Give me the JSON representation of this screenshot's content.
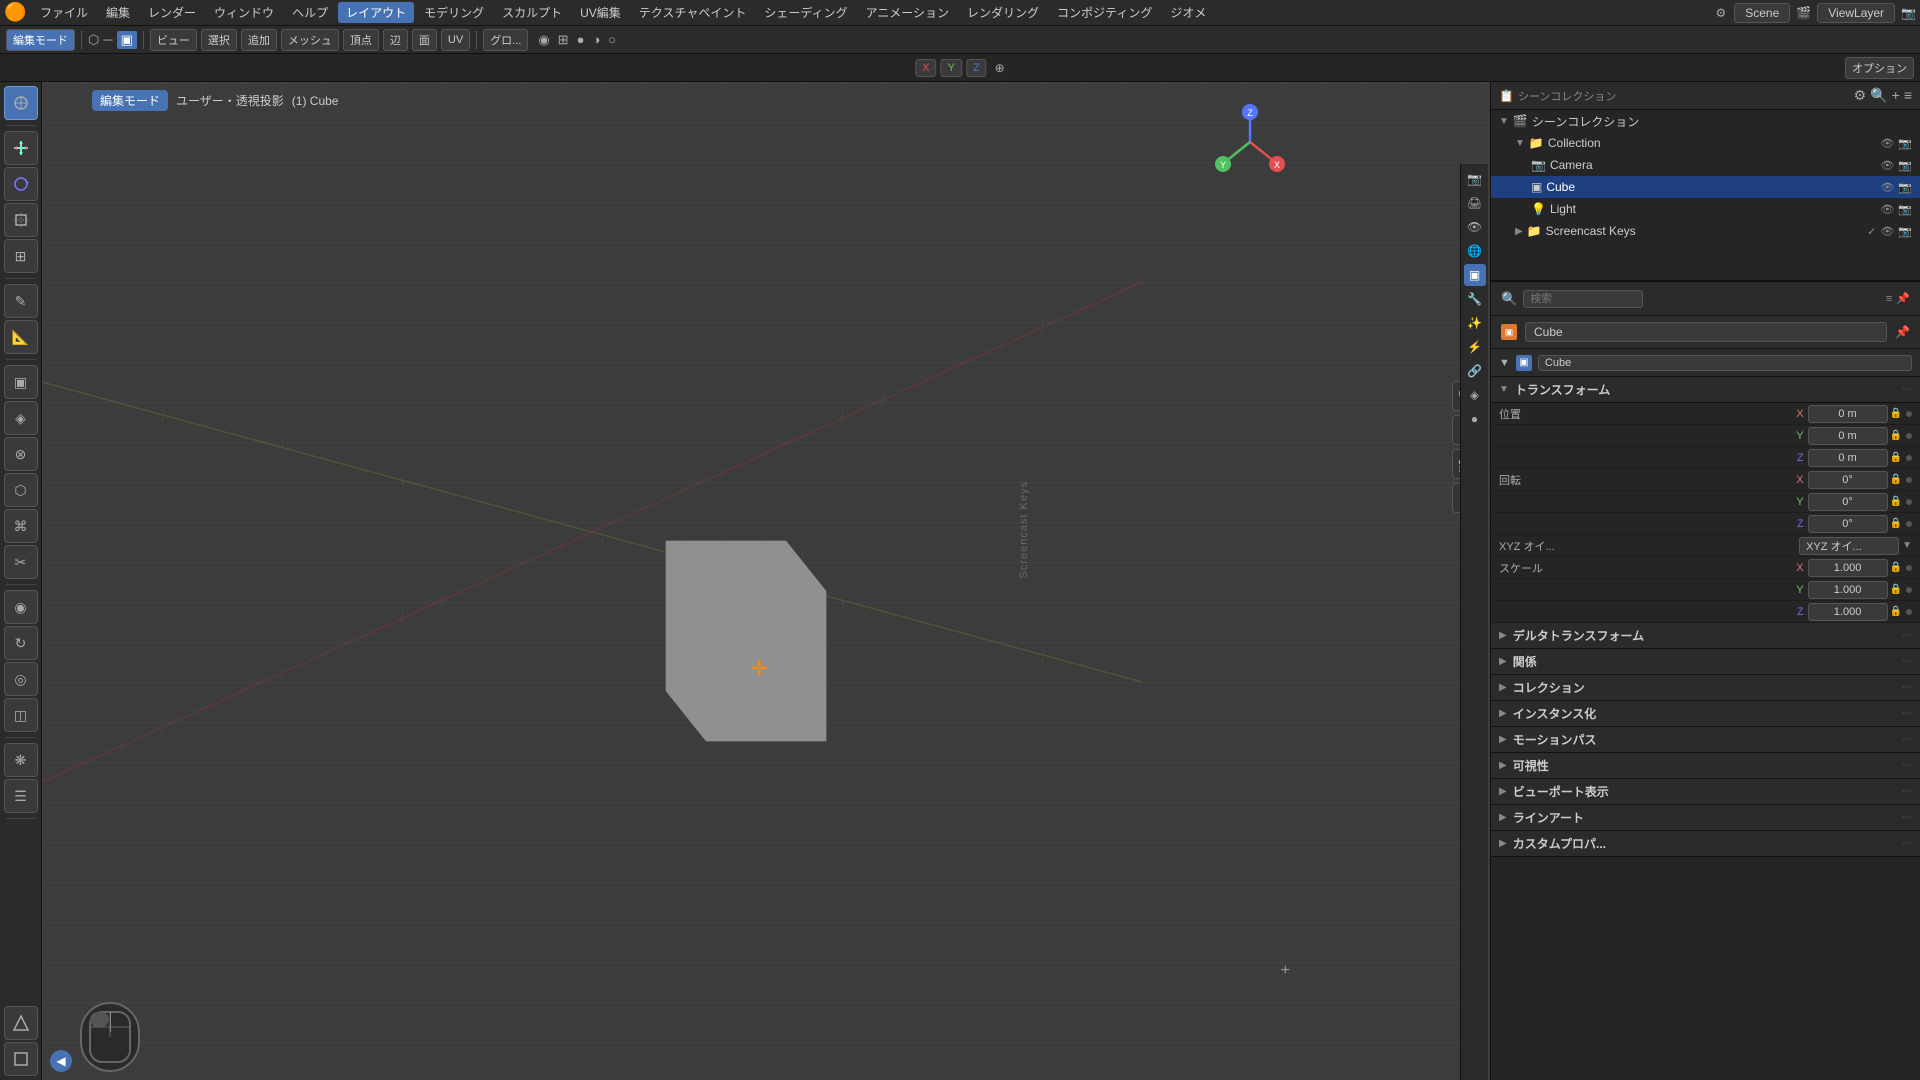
{
  "app": {
    "title": "Blender"
  },
  "top_menu": {
    "logo": "🟠",
    "items": [
      "ファイル",
      "編集",
      "レンダー",
      "ウィンドウ",
      "ヘルプ"
    ],
    "workspace_tabs": [
      "レイアウト",
      "モデリング",
      "スカルプト",
      "UV編集",
      "テクスチャペイント",
      "シェーディング",
      "アニメーション",
      "レンダリング",
      "コンポジティング",
      "ジオメ"
    ],
    "active_workspace": "レイアウト",
    "scene_label": "Scene",
    "viewlayer_label": "ViewLayer"
  },
  "second_toolbar": {
    "mode_label": "編集モード",
    "view_label": "ビュー",
    "select_label": "選択",
    "add_label": "追加",
    "mesh_label": "メッシュ",
    "vertex_label": "頂点",
    "edge_label": "辺",
    "face_label": "面",
    "uv_label": "UV",
    "proportional_label": "グロ..."
  },
  "mode_toolbar": {
    "coord_x": "X",
    "coord_y": "Y",
    "coord_z": "Z",
    "options_label": "オプション"
  },
  "viewport": {
    "mode": "編集モード",
    "perspective_label": "ユーザー・透視投影",
    "object_label": "(1) Cube",
    "cursor_symbol": "✛"
  },
  "gizmo": {
    "x_label": "X",
    "y_label": "Y",
    "z_label": "Z"
  },
  "outliner": {
    "title": "シーンコレクション",
    "search_placeholder": "検索",
    "items": [
      {
        "label": "Collection",
        "indent": 0,
        "icon": "📁",
        "expanded": true,
        "id": "collection"
      },
      {
        "label": "Camera",
        "indent": 1,
        "icon": "📷",
        "id": "camera"
      },
      {
        "label": "Cube",
        "indent": 1,
        "icon": "▣",
        "id": "cube",
        "selected": true
      },
      {
        "label": "Light",
        "indent": 1,
        "icon": "💡",
        "id": "light"
      }
    ],
    "sub_items": [
      {
        "label": "Screencast Keys",
        "indent": 0,
        "icon": "📁",
        "id": "screencast-keys"
      }
    ]
  },
  "properties": {
    "object_name": "Cube",
    "mesh_name": "Cube",
    "sections": {
      "transform": {
        "label": "トランスフォーム",
        "location": {
          "label": "位置",
          "x": "0 m",
          "y": "0 m",
          "z": "0 m"
        },
        "rotation": {
          "label": "回転",
          "x": "0°",
          "y": "0°",
          "z": "0°",
          "mode": "XYZ オイ..."
        },
        "scale": {
          "label": "スケール",
          "x": "1.000",
          "y": "1.000",
          "z": "1.000"
        }
      },
      "delta_transform": {
        "label": "デルタトランスフォーム",
        "collapsed": true
      },
      "relations": {
        "label": "関係",
        "collapsed": true
      },
      "collection": {
        "label": "コレクション",
        "collapsed": true
      },
      "instancing": {
        "label": "インスタンス化",
        "collapsed": true
      },
      "motion_path": {
        "label": "モーションパス",
        "collapsed": true
      },
      "visibility": {
        "label": "可視性",
        "collapsed": true
      },
      "viewport_display": {
        "label": "ビューポート表示",
        "collapsed": true
      },
      "line_art": {
        "label": "ラインアート",
        "collapsed": true
      },
      "custom_props": {
        "label": "カスタムプロパ...",
        "collapsed": true
      }
    }
  },
  "left_tools": [
    {
      "icon": "↔",
      "label": "move-tool",
      "active": true
    },
    {
      "icon": "↻",
      "label": "rotate-tool"
    },
    {
      "icon": "⤢",
      "label": "scale-tool"
    },
    {
      "icon": "⊞",
      "label": "transform-tool"
    },
    {
      "icon": "⊕",
      "label": "annotate-tool"
    },
    {
      "icon": "✎",
      "label": "draw-tool"
    },
    {
      "icon": "📐",
      "label": "measure-tool"
    },
    {
      "icon": "▣",
      "label": "add-cube-tool"
    },
    {
      "icon": "◈",
      "label": "extrude-tool"
    },
    {
      "icon": "⊗",
      "label": "inset-tool"
    },
    {
      "icon": "⊞",
      "label": "bevel-tool"
    },
    {
      "icon": "⌘",
      "label": "loop-cut-tool"
    },
    {
      "icon": "✂",
      "label": "knife-tool"
    },
    {
      "icon": "⬡",
      "label": "poly-build-tool"
    },
    {
      "icon": "◉",
      "label": "spin-tool"
    },
    {
      "icon": "🔧",
      "label": "smooth-tool"
    },
    {
      "icon": "◎",
      "label": "edge-slide-tool"
    },
    {
      "icon": "◫",
      "label": "shrink-fatten-tool"
    },
    {
      "icon": "❋",
      "label": "push-pull-tool"
    },
    {
      "icon": "☰",
      "label": "shear-tool"
    }
  ]
}
